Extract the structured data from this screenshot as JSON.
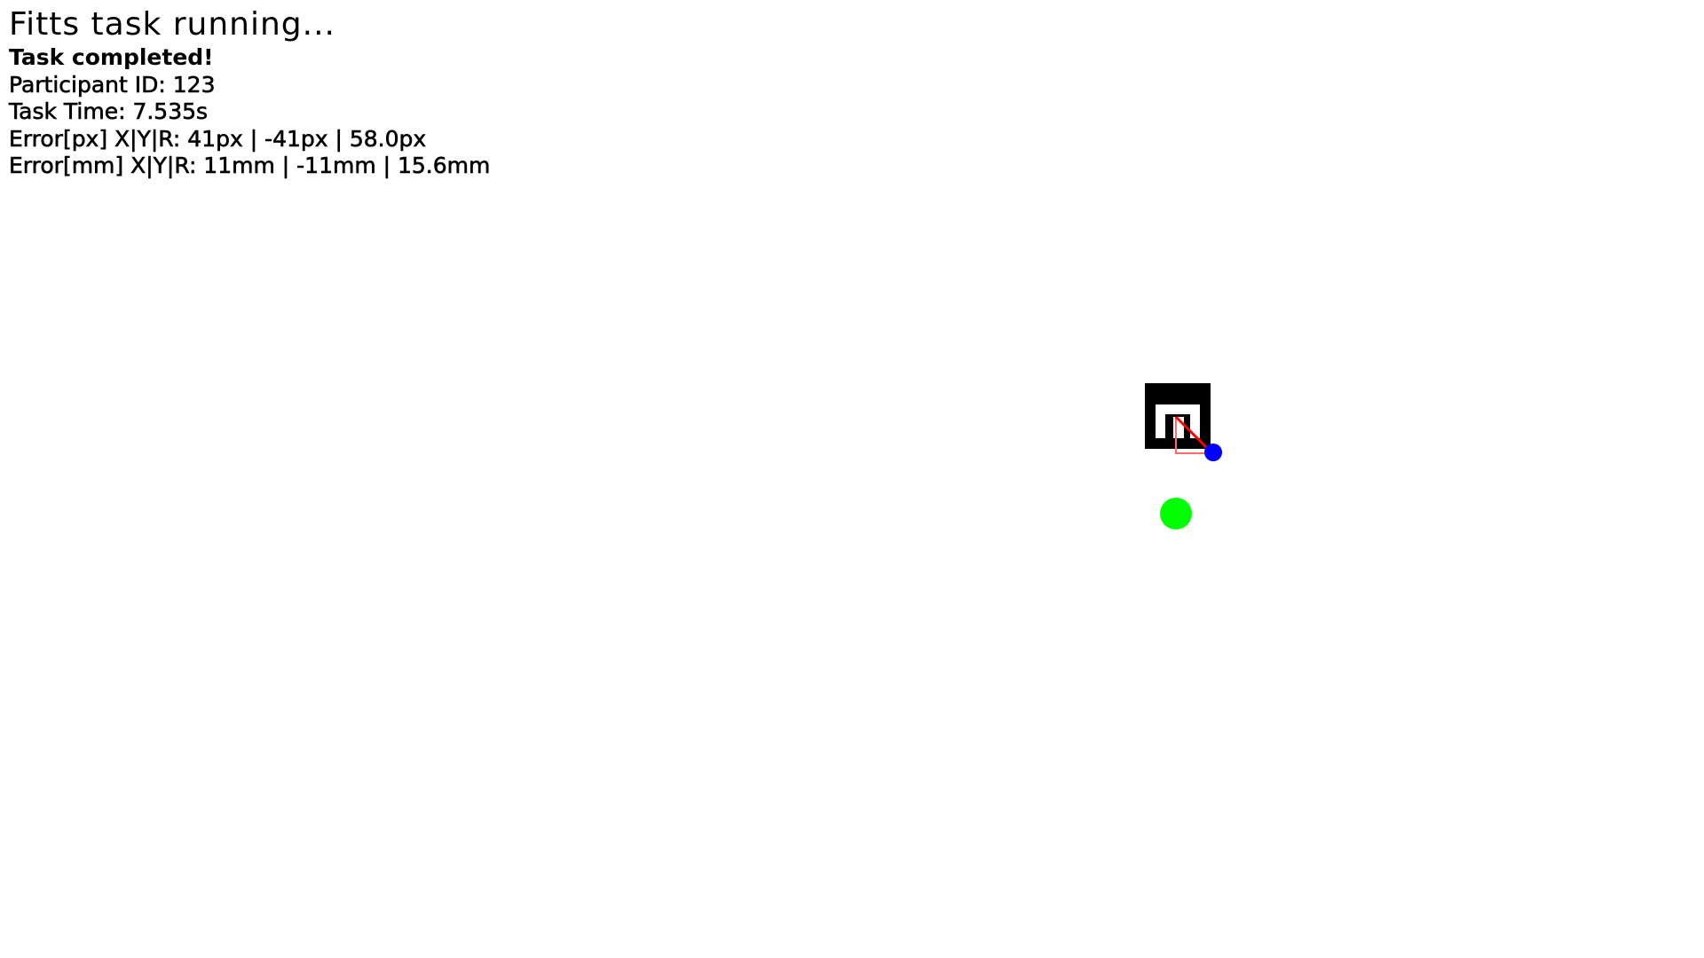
{
  "title": "Fitts task running...",
  "status": "Task completed!",
  "participant": "Participant ID: 123",
  "task_time": "Task Time: 7.535s",
  "error_px": "Error[px] X|Y|R: 41px | -41px | 58.0px",
  "error_mm": "Error[mm] X|Y|R: 11mm | -11mm | 15.6mm",
  "colors": {
    "background": "#ffffff",
    "text": "#000000",
    "marker": "#000000",
    "marker_inner": "#ffffff",
    "error_line": "#ff0000",
    "error_triangle": "#ff6b6b",
    "cursor_dot": "#0000ff",
    "target": "#00ff00"
  },
  "icons": {
    "marker": "fiducial-marker-icon",
    "cursor": "blue-dot-icon",
    "target": "green-target-icon"
  }
}
